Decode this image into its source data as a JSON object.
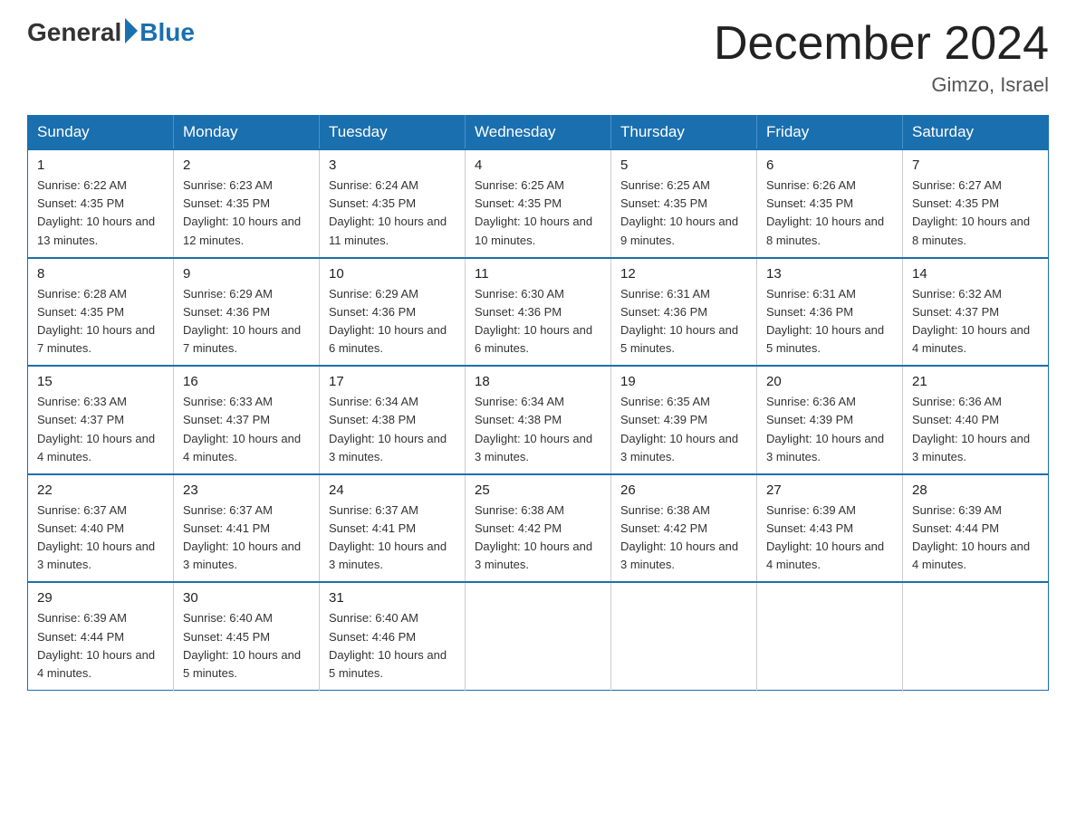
{
  "logo": {
    "general": "General",
    "blue": "Blue"
  },
  "title": {
    "month_year": "December 2024",
    "location": "Gimzo, Israel"
  },
  "days_of_week": [
    "Sunday",
    "Monday",
    "Tuesday",
    "Wednesday",
    "Thursday",
    "Friday",
    "Saturday"
  ],
  "weeks": [
    [
      {
        "day": "1",
        "sunrise": "6:22 AM",
        "sunset": "4:35 PM",
        "daylight": "10 hours and 13 minutes."
      },
      {
        "day": "2",
        "sunrise": "6:23 AM",
        "sunset": "4:35 PM",
        "daylight": "10 hours and 12 minutes."
      },
      {
        "day": "3",
        "sunrise": "6:24 AM",
        "sunset": "4:35 PM",
        "daylight": "10 hours and 11 minutes."
      },
      {
        "day": "4",
        "sunrise": "6:25 AM",
        "sunset": "4:35 PM",
        "daylight": "10 hours and 10 minutes."
      },
      {
        "day": "5",
        "sunrise": "6:25 AM",
        "sunset": "4:35 PM",
        "daylight": "10 hours and 9 minutes."
      },
      {
        "day": "6",
        "sunrise": "6:26 AM",
        "sunset": "4:35 PM",
        "daylight": "10 hours and 8 minutes."
      },
      {
        "day": "7",
        "sunrise": "6:27 AM",
        "sunset": "4:35 PM",
        "daylight": "10 hours and 8 minutes."
      }
    ],
    [
      {
        "day": "8",
        "sunrise": "6:28 AM",
        "sunset": "4:35 PM",
        "daylight": "10 hours and 7 minutes."
      },
      {
        "day": "9",
        "sunrise": "6:29 AM",
        "sunset": "4:36 PM",
        "daylight": "10 hours and 7 minutes."
      },
      {
        "day": "10",
        "sunrise": "6:29 AM",
        "sunset": "4:36 PM",
        "daylight": "10 hours and 6 minutes."
      },
      {
        "day": "11",
        "sunrise": "6:30 AM",
        "sunset": "4:36 PM",
        "daylight": "10 hours and 6 minutes."
      },
      {
        "day": "12",
        "sunrise": "6:31 AM",
        "sunset": "4:36 PM",
        "daylight": "10 hours and 5 minutes."
      },
      {
        "day": "13",
        "sunrise": "6:31 AM",
        "sunset": "4:36 PM",
        "daylight": "10 hours and 5 minutes."
      },
      {
        "day": "14",
        "sunrise": "6:32 AM",
        "sunset": "4:37 PM",
        "daylight": "10 hours and 4 minutes."
      }
    ],
    [
      {
        "day": "15",
        "sunrise": "6:33 AM",
        "sunset": "4:37 PM",
        "daylight": "10 hours and 4 minutes."
      },
      {
        "day": "16",
        "sunrise": "6:33 AM",
        "sunset": "4:37 PM",
        "daylight": "10 hours and 4 minutes."
      },
      {
        "day": "17",
        "sunrise": "6:34 AM",
        "sunset": "4:38 PM",
        "daylight": "10 hours and 3 minutes."
      },
      {
        "day": "18",
        "sunrise": "6:34 AM",
        "sunset": "4:38 PM",
        "daylight": "10 hours and 3 minutes."
      },
      {
        "day": "19",
        "sunrise": "6:35 AM",
        "sunset": "4:39 PM",
        "daylight": "10 hours and 3 minutes."
      },
      {
        "day": "20",
        "sunrise": "6:36 AM",
        "sunset": "4:39 PM",
        "daylight": "10 hours and 3 minutes."
      },
      {
        "day": "21",
        "sunrise": "6:36 AM",
        "sunset": "4:40 PM",
        "daylight": "10 hours and 3 minutes."
      }
    ],
    [
      {
        "day": "22",
        "sunrise": "6:37 AM",
        "sunset": "4:40 PM",
        "daylight": "10 hours and 3 minutes."
      },
      {
        "day": "23",
        "sunrise": "6:37 AM",
        "sunset": "4:41 PM",
        "daylight": "10 hours and 3 minutes."
      },
      {
        "day": "24",
        "sunrise": "6:37 AM",
        "sunset": "4:41 PM",
        "daylight": "10 hours and 3 minutes."
      },
      {
        "day": "25",
        "sunrise": "6:38 AM",
        "sunset": "4:42 PM",
        "daylight": "10 hours and 3 minutes."
      },
      {
        "day": "26",
        "sunrise": "6:38 AM",
        "sunset": "4:42 PM",
        "daylight": "10 hours and 3 minutes."
      },
      {
        "day": "27",
        "sunrise": "6:39 AM",
        "sunset": "4:43 PM",
        "daylight": "10 hours and 4 minutes."
      },
      {
        "day": "28",
        "sunrise": "6:39 AM",
        "sunset": "4:44 PM",
        "daylight": "10 hours and 4 minutes."
      }
    ],
    [
      {
        "day": "29",
        "sunrise": "6:39 AM",
        "sunset": "4:44 PM",
        "daylight": "10 hours and 4 minutes."
      },
      {
        "day": "30",
        "sunrise": "6:40 AM",
        "sunset": "4:45 PM",
        "daylight": "10 hours and 5 minutes."
      },
      {
        "day": "31",
        "sunrise": "6:40 AM",
        "sunset": "4:46 PM",
        "daylight": "10 hours and 5 minutes."
      },
      null,
      null,
      null,
      null
    ]
  ]
}
